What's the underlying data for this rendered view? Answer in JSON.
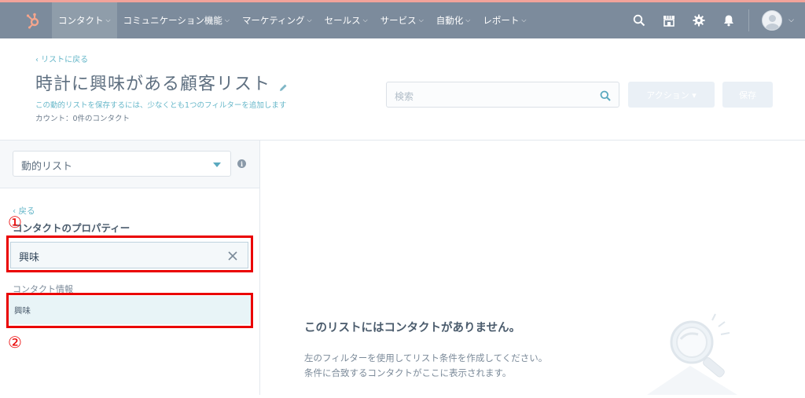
{
  "nav": {
    "items": [
      {
        "label": "コンタクト",
        "active": true
      },
      {
        "label": "コミュニケーション機能"
      },
      {
        "label": "マーケティング"
      },
      {
        "label": "セールス"
      },
      {
        "label": "サービス"
      },
      {
        "label": "自動化"
      },
      {
        "label": "レポート"
      }
    ],
    "accent": "#f2a39a",
    "bg": "#7c8b9c"
  },
  "header": {
    "back_link": "‹ リストに戻る",
    "title": "時計に興味がある顧客リスト",
    "hint": "この動的リストを保存するには、少なくとも1つのフィルターを追加します",
    "count": "カウント：0件のコンタクト",
    "search_placeholder": "検索",
    "action_label": "アクション ▾",
    "save_label": "保存"
  },
  "left_panel": {
    "list_type": "動的リスト",
    "back_link": "‹ 戻る",
    "property_title": "コンタクトのプロパティー",
    "search_value": "興味",
    "group_header": "コンタクト情報",
    "result_item": "興味"
  },
  "annotations": {
    "marker1": "①",
    "marker2": "②",
    "color": "#ea0000"
  },
  "empty_state": {
    "title": "このリストにはコンタクトがありません。",
    "line1": "左のフィルターを使用してリスト条件を作成してください。",
    "line2": "条件に合致するコンタクトがここに表示されます。"
  }
}
